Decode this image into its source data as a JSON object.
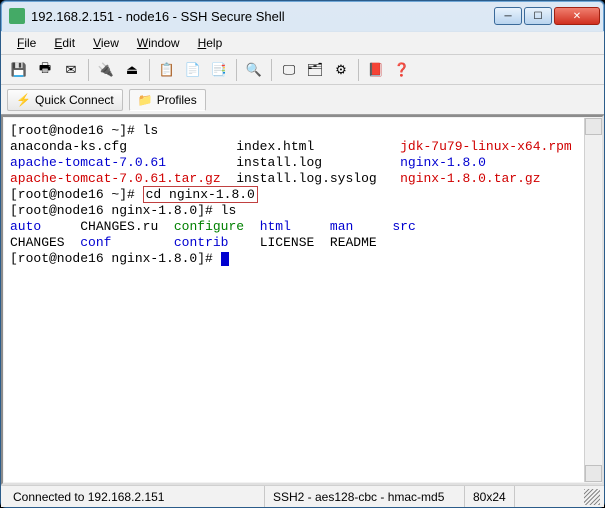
{
  "window": {
    "title": "192.168.2.151 - node16 - SSH Secure Shell"
  },
  "menu": {
    "file": "File",
    "edit": "Edit",
    "view": "View",
    "window": "Window",
    "help": "Help"
  },
  "toolbar2": {
    "quick_connect": "Quick Connect",
    "profiles": "Profiles"
  },
  "terminal": {
    "prompt1": "[root@node16 ~]# ",
    "cmd_ls": "ls",
    "files_row1": {
      "c1": "anaconda-ks.cfg",
      "c2": "index.html",
      "c3": "jdk-7u79-linux-x64.rpm"
    },
    "files_row2": {
      "c1": "apache-tomcat-7.0.61",
      "c2": "install.log",
      "c3": "nginx-1.8.0"
    },
    "files_row3": {
      "c1": "apache-tomcat-7.0.61.tar.gz",
      "c2": "install.log.syslog",
      "c3": "nginx-1.8.0.tar.gz"
    },
    "prompt2": "[root@node16 ~]# ",
    "cmd_cd": "cd nginx-1.8.0",
    "prompt3": "[root@node16 nginx-1.8.0]# ",
    "cmd_ls2": "ls",
    "ng_row1": {
      "c1": "auto",
      "c2": "CHANGES.ru",
      "c3": "configure",
      "c4": "html",
      "c5": "man",
      "c6": "src"
    },
    "ng_row2": {
      "c1": "CHANGES",
      "c2": "conf",
      "c3": "contrib",
      "c4": "LICENSE",
      "c5": "README"
    },
    "prompt4": "[root@node16 nginx-1.8.0]# "
  },
  "status": {
    "connected": "Connected to 192.168.2.151",
    "cipher": "SSH2 - aes128-cbc - hmac-md5",
    "size": "80x24"
  }
}
